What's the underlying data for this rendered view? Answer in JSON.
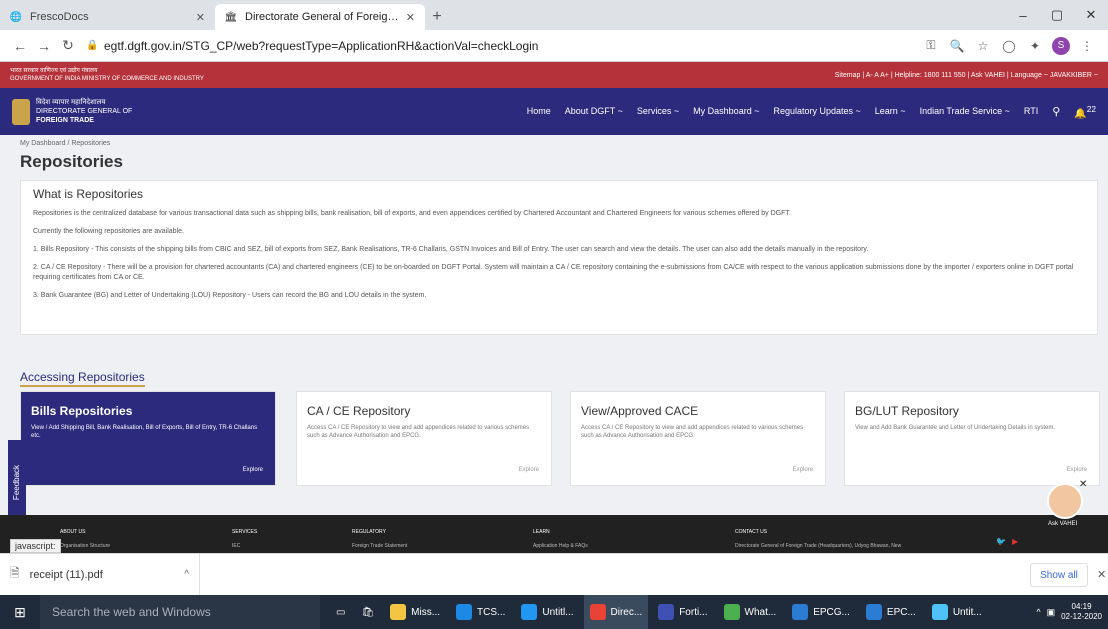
{
  "browser": {
    "tabs": [
      {
        "label": "FrescoDocs",
        "icon": "globe-icon"
      },
      {
        "label": "Directorate General of Foreign T",
        "icon": "dgft-icon"
      }
    ],
    "new_tab": "+",
    "window_controls": {
      "minimize": "–",
      "maximize": "▢",
      "close": "✕"
    },
    "url": "egtf.dgft.gov.in/STG_CP/web?requestType=ApplicationRH&actionVal=checkLogin",
    "profile_initial": "S"
  },
  "govbar": {
    "hindi_top": "भारत सरकार  वाणिज्य एवं उद्योग मंत्रालय",
    "hindi_sub": "GOVERNMENT OF INDIA  MINISTRY OF COMMERCE AND INDUSTRY",
    "right": "Sitemap  |  A-  A  A+  |  Helpline: 1800 111 550  |  Ask VAHEI  |  Language  ~  JAVAKKIBER  ~"
  },
  "logo": {
    "hindi": "विदेश व्यापार महानिदेशालय",
    "line1": "DIRECTORATE GENERAL OF",
    "line2": "FOREIGN TRADE"
  },
  "nav": {
    "items": [
      "Home",
      "About DGFT ~",
      "Services ~",
      "My Dashboard ~",
      "Regulatory Updates ~",
      "Learn ~",
      "Indian Trade Service ~",
      "RTI"
    ],
    "notification_count": "22"
  },
  "page": {
    "breadcrumb": "My Dashboard  /  Repositories",
    "title": "Repositories"
  },
  "info": {
    "title": "What is Repositories",
    "paragraphs": [
      "Repositories is the centralized database for various transactional data such as shipping bills, bank realisation, bill of exports, and even appendices certified by Chartered Accountant and Chartered Engineers for various schemes offered by DGFT.",
      "Currently the following repositories are available.",
      "1. Bills Repository - This consists of the shipping bills from CBIC and SEZ, bill of exports from SEZ, Bank Realisations, TR-6 Challans, GSTN Invoices and Bill of Entry. The user can search and view the details. The user can also add the details manually in the repository.",
      "2. CA / CE Repository - There will be a provision for chartered accountants (CA) and chartered engineers (CE) to be on-boarded on DGFT Portal. System will maintain a CA / CE repository containing the e-submissions from CA/CE with respect to the various application submissions done by the importer / exporters online in DGFT portal requiring certificates from CA or CE.",
      "3. Bank Guarantee (BG) and Letter of Undertaking (LOU) Repository - Users can record the BG and LOU details in the system."
    ]
  },
  "accessing": {
    "title": "Accessing Repositories",
    "cards": [
      {
        "title": "Bills Repositories",
        "desc": "View / Add Shipping Bill, Bank Realisation, Bill of Exports, Bill of Entry, TR-6 Challans etc.",
        "explore": "Explore"
      },
      {
        "title": "CA / CE Repository",
        "desc": "Access CA / CE Repository to view and add appendices related to various schemes such as Advance Authorisation and EPCG.",
        "explore": "Explore"
      },
      {
        "title": "View/Approved CACE",
        "desc": "Access CA / CE Repository to view and add appendices related to various schemes such as Advance Authorisation and EPCG.",
        "explore": "Explore"
      },
      {
        "title": "BG/LUT Repository",
        "desc": "View and Add Bank Guarantee and Letter of Undertaking Details in system.",
        "explore": "Explore"
      }
    ]
  },
  "feedback": "Feedback",
  "assistant": {
    "label": "Ask VAHEI",
    "close": "✕"
  },
  "footer": {
    "columns": [
      {
        "title": "ABOUT US",
        "sub": "Organisation Structure"
      },
      {
        "title": "SERVICES",
        "sub": "IEC"
      },
      {
        "title": "REGULATORY",
        "sub": "Foreign Trade Statement"
      },
      {
        "title": "LEARN",
        "sub": "Application Help & FAQs"
      },
      {
        "title": "CONTACT US",
        "sub": "Directorate General of Foreign Trade (Headquarters), Udyog Bhawan, New"
      }
    ]
  },
  "status": "javascript:",
  "download": {
    "file": "receipt (11).pdf",
    "show_all": "Show all",
    "close": "✕"
  },
  "taskbar": {
    "search_placeholder": "Search the web and Windows",
    "apps": [
      {
        "label": "Miss...",
        "color": "#f4c542"
      },
      {
        "label": "TCS...",
        "color": "#1e88e5"
      },
      {
        "label": "Untitl...",
        "color": "#2196f3"
      },
      {
        "label": "Direc...",
        "color": "#ea4335"
      },
      {
        "label": "Forti...",
        "color": "#3f51b5"
      },
      {
        "label": "What...",
        "color": "#4caf50"
      },
      {
        "label": "EPCG...",
        "color": "#2b7cd3"
      },
      {
        "label": "EPC...",
        "color": "#2b7cd3"
      },
      {
        "label": "Untit...",
        "color": "#4fc3f7"
      }
    ],
    "time": "04:19",
    "date": "02-12-2020"
  },
  "colors": {
    "brand": "#2c2a7c",
    "govbar": "#b5323a",
    "footer": "#212121"
  }
}
